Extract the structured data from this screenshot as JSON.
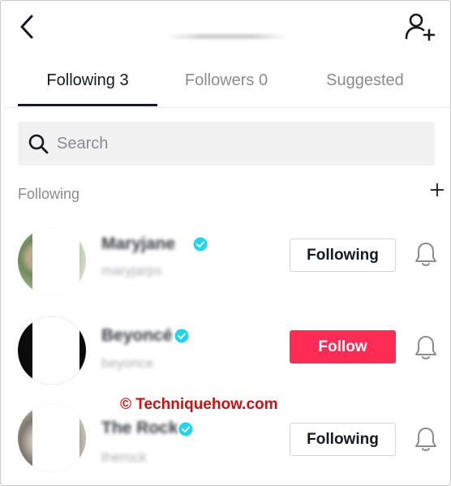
{
  "header": {
    "back_icon": "chevron-left-icon",
    "add_user_icon": "add-user-icon"
  },
  "tabs": [
    {
      "label": "Following 3",
      "active": true
    },
    {
      "label": "Followers 0",
      "active": false
    },
    {
      "label": "Suggested",
      "active": false
    }
  ],
  "search": {
    "placeholder": "Search",
    "value": ""
  },
  "section": {
    "label": "Following"
  },
  "users": [
    {
      "name": "Maryjane",
      "handle": "maryjarps",
      "verified": true,
      "button": "Following",
      "button_style": "outline"
    },
    {
      "name": "Beyoncé",
      "handle": "beyonce",
      "verified": true,
      "button": "Follow",
      "button_style": "filled"
    },
    {
      "name": "The Rock",
      "handle": "therock",
      "verified": true,
      "button": "Following",
      "button_style": "outline"
    }
  ],
  "watermark": "© Techniquehow.com",
  "colors": {
    "accent": "#fe2c55",
    "verified": "#20d5ec",
    "text": "#161823",
    "muted": "#8a8b91"
  }
}
